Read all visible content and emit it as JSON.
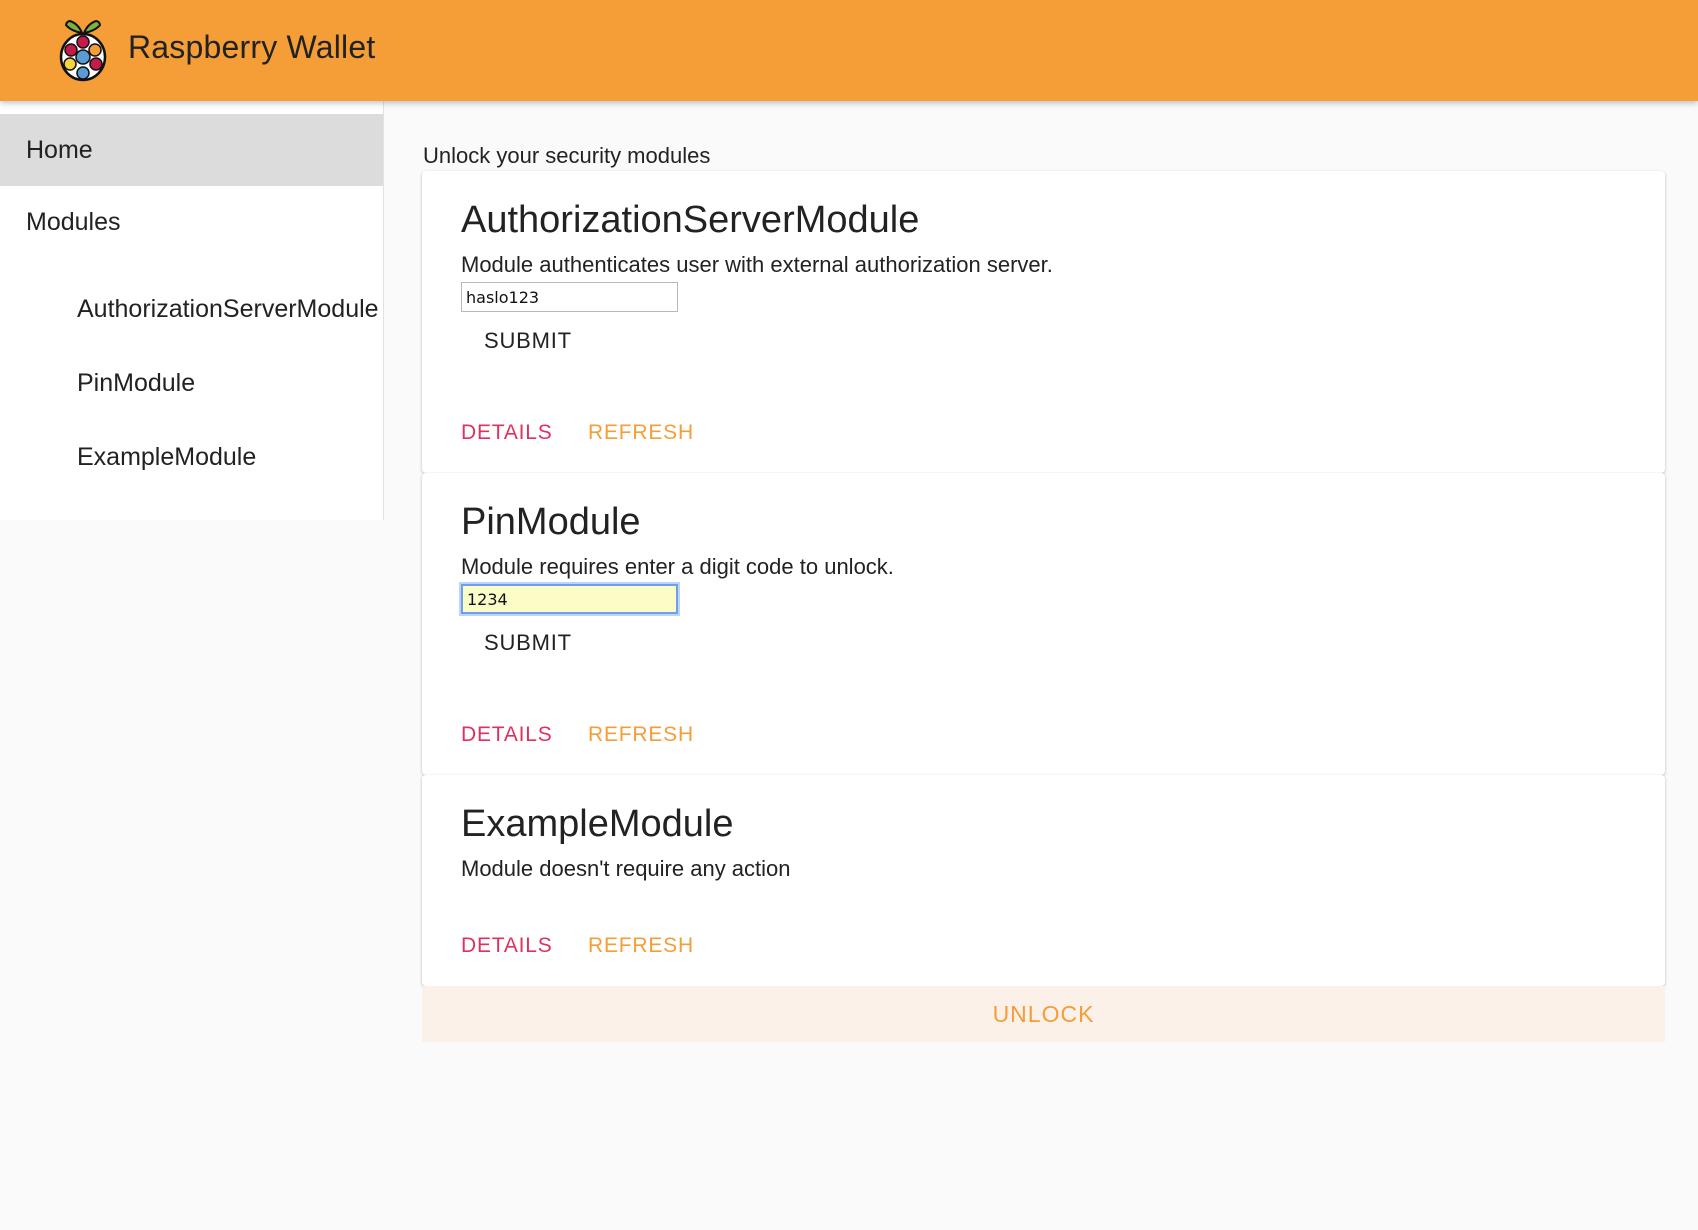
{
  "app": {
    "title": "Raspberry Wallet",
    "logo_icon": "raspberry-pi-logo-icon",
    "accent_color": "#f59e38"
  },
  "sidebar": {
    "home": "Home",
    "modules": "Modules",
    "items": [
      {
        "label": "AuthorizationServerModule"
      },
      {
        "label": "PinModule"
      },
      {
        "label": "ExampleModule"
      }
    ]
  },
  "main": {
    "subtitle": "Unlock your security modules",
    "cards": [
      {
        "title": "AuthorizationServerModule",
        "description": "Module authenticates user with external authorization server.",
        "input_value": "haslo123",
        "submit": "SUBMIT",
        "details": "DETAILS",
        "refresh": "REFRESH"
      },
      {
        "title": "PinModule",
        "description": "Module requires enter a digit code to unlock.",
        "input_value": "1234",
        "submit": "SUBMIT",
        "details": "DETAILS",
        "refresh": "REFRESH"
      },
      {
        "title": "ExampleModule",
        "description": "Module doesn't require any action",
        "details": "DETAILS",
        "refresh": "REFRESH"
      }
    ],
    "unlock": "UNLOCK"
  },
  "colors": {
    "details": "#e0305f",
    "refresh": "#f59e38",
    "unlock_bg": "#fbf1e8"
  }
}
